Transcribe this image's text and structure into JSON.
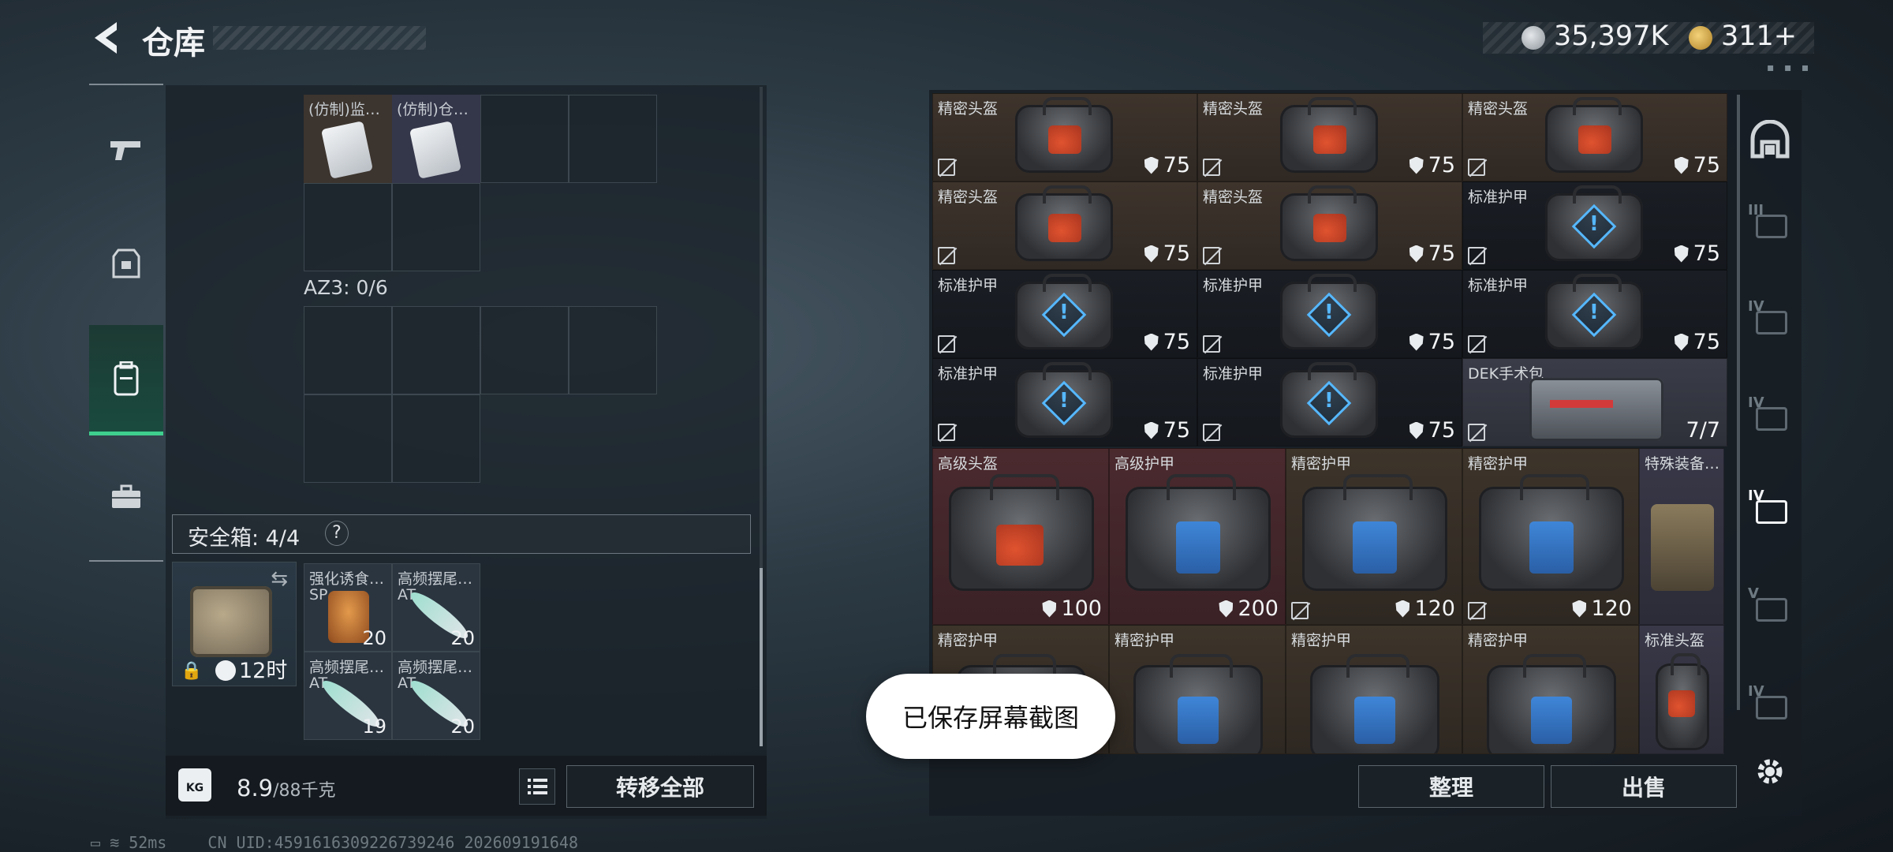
{
  "header": {
    "title": "仓库",
    "currency_a": "35,397K",
    "currency_b": "311+",
    "colors": {
      "currency_a": "#b9c0c6",
      "currency_b": "#d4a947"
    }
  },
  "left_nav": [
    "gun-icon",
    "armor-icon",
    "backpack-icon",
    "briefcase-icon"
  ],
  "left_panel": {
    "top_items": [
      {
        "label": "(仿制)监…"
      },
      {
        "label": "(仿制)仓…"
      }
    ],
    "az3_label": "AZ3: 0/6",
    "safe_box_label": "安全箱: 4/4",
    "help": "?",
    "safe_box_time": "12时",
    "safe_items": [
      {
        "label": "强化诱食…",
        "sub": "SP",
        "count": "20"
      },
      {
        "label": "高频摆尾…",
        "sub": "AT",
        "count": "20"
      },
      {
        "label": "高频摆尾…",
        "sub": "AT",
        "count": "19"
      },
      {
        "label": "高频摆尾…",
        "sub": "AT",
        "count": "20"
      }
    ],
    "weight_icon": "KG",
    "weight_value": "8.9",
    "weight_max": "/88千克",
    "transfer_all": "转移全部"
  },
  "right_grid": {
    "small_rows": [
      [
        {
          "label": "精密头盔",
          "value": "75",
          "kind": "helmet"
        },
        {
          "label": "精密头盔",
          "value": "75",
          "kind": "helmet"
        },
        {
          "label": "精密头盔",
          "value": "75",
          "kind": "helmet"
        }
      ],
      [
        {
          "label": "精密头盔",
          "value": "75",
          "kind": "helmet"
        },
        {
          "label": "精密头盔",
          "value": "75",
          "kind": "helmet"
        },
        {
          "label": "标准护甲",
          "value": "75",
          "kind": "armor"
        }
      ],
      [
        {
          "label": "标准护甲",
          "value": "75",
          "kind": "armor"
        },
        {
          "label": "标准护甲",
          "value": "75",
          "kind": "armor"
        },
        {
          "label": "标准护甲",
          "value": "75",
          "kind": "armor"
        }
      ],
      [
        {
          "label": "标准护甲",
          "value": "75",
          "kind": "armor"
        },
        {
          "label": "标准护甲",
          "value": "75",
          "kind": "armor"
        },
        {
          "label": "DEK手术包",
          "value": "7/7",
          "kind": "medkit"
        }
      ]
    ],
    "big_row": [
      {
        "label": "高级头盔",
        "value": "100"
      },
      {
        "label": "高级护甲",
        "value": "200"
      },
      {
        "label": "精密护甲",
        "value": "120"
      },
      {
        "label": "精密护甲",
        "value": "120"
      },
      {
        "label": "特殊装备…"
      }
    ],
    "bottom_row": [
      {
        "label": "精密护甲"
      },
      {
        "label": "精密护甲"
      },
      {
        "label": "精密护甲"
      },
      {
        "label": "精密护甲"
      },
      {
        "label": "标准头盔"
      }
    ],
    "sort": "整理",
    "sell": "出售"
  },
  "right_tools": [
    "",
    "III",
    "IV",
    "IV",
    "IV",
    "V",
    "IV"
  ],
  "toast": "已保存屏幕截图",
  "footer": {
    "ping": "52ms",
    "uid": "CN UID:4591616309226739246 202609191648"
  }
}
